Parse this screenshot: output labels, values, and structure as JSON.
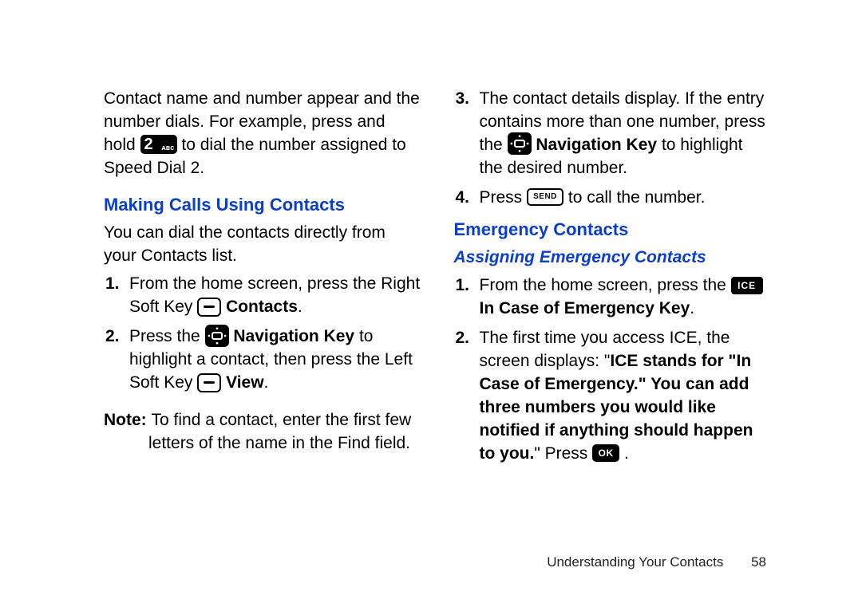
{
  "intro": {
    "part1": "Contact name and number appear and the number dials. For example, press and hold ",
    "part2": " to dial the number assigned to Speed Dial 2."
  },
  "section_making_calls": {
    "heading": "Making Calls Using Contacts",
    "intro": "You can dial the contacts directly from your Contacts list.",
    "steps": [
      {
        "num": "1.",
        "pre": "From the home screen, press the Right Soft Key ",
        "bold_post_icon": " Contacts",
        "post": "."
      },
      {
        "num": "2.",
        "pre": "Press the ",
        "bold_post_icon": " Navigation Key",
        "mid": " to highlight a contact, then press the Left Soft Key ",
        "bold_post_icon2": " View",
        "post": "."
      }
    ],
    "note_label": "Note: ",
    "note_body": "To find a contact, enter the first few letters of the name in the Find field."
  },
  "right_prepend_steps": [
    {
      "num": "3.",
      "pre": "The contact details display. If the entry contains more than one number, press the ",
      "bold_post_icon": " Navigation Key",
      "post": " to highlight the desired number."
    },
    {
      "num": "4.",
      "pre": "Press ",
      "post": " to call the number."
    }
  ],
  "section_emergency": {
    "heading": "Emergency Contacts",
    "sub": "Assigning Emergency Contacts",
    "steps": [
      {
        "num": "1.",
        "pre": "From the home screen, press the ",
        "bold_post_icon": " In Case of Emergency Key",
        "post": "."
      },
      {
        "num": "2.",
        "pre": "The first time you access ICE, the screen displays: \"",
        "bold_mid": "ICE stands for \"In Case of Emergency.\" You can add three numbers you would like notified if anything should happen to you.",
        "mid2": "\" Press ",
        "post": "."
      }
    ]
  },
  "footer": {
    "chapter": "Understanding Your Contacts",
    "page": "58"
  }
}
